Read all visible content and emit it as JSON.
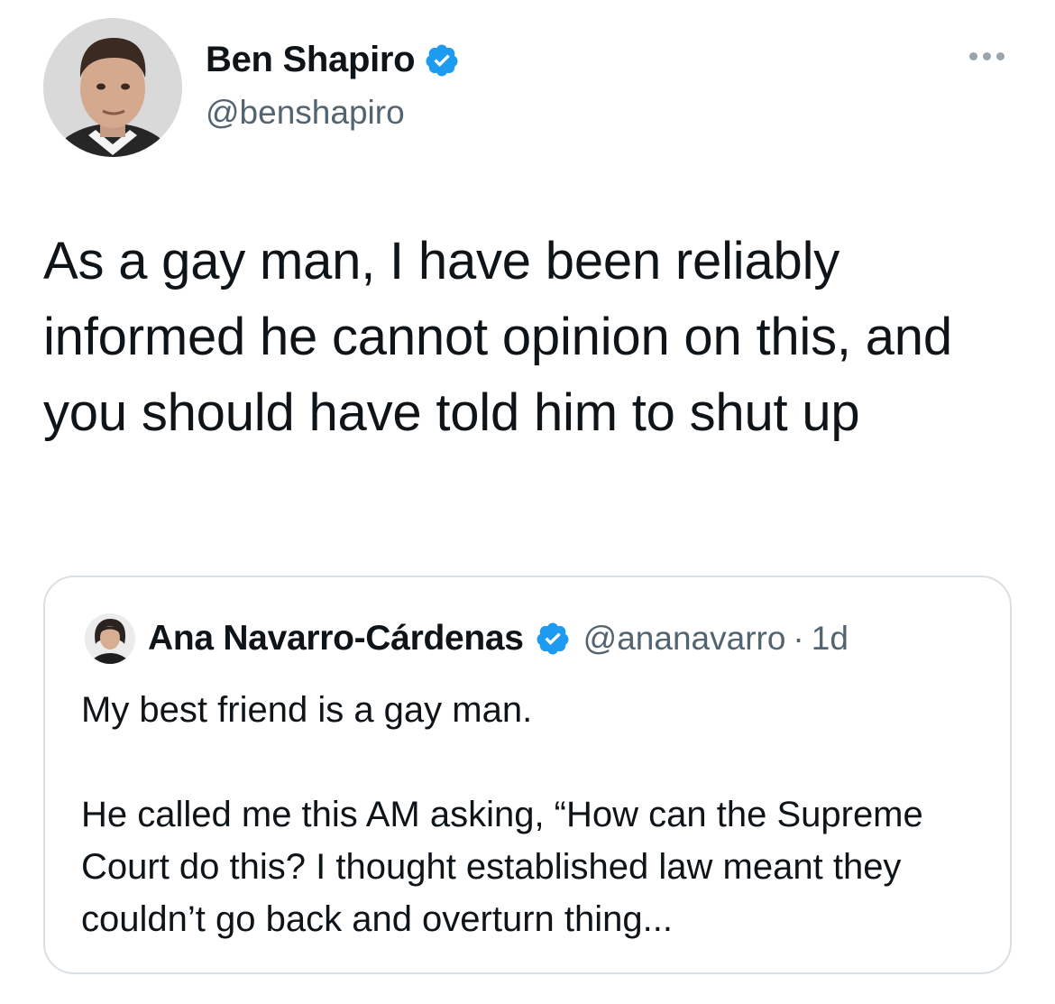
{
  "author": {
    "display_name": "Ben Shapiro",
    "handle": "@benshapiro",
    "verified": true,
    "avatar_icon": "profile-photo"
  },
  "tweet": {
    "text": "As a gay man, I have been reliably informed he cannot opinion on this, and you should have told him to shut up"
  },
  "quoted_tweet": {
    "display_name": "Ana Navarro-Cárdenas",
    "handle": "@ananavarro",
    "separator": "·",
    "time": "1d",
    "verified": true,
    "paragraphs": [
      "My best friend is a gay man.",
      "He called me this AM asking, “How can the Supreme Court do this? I thought established law meant they couldn’t go back and overturn thing..."
    ]
  },
  "colors": {
    "text": "#0f1419",
    "secondary": "#536471",
    "verified_badge": "#1d9bf0",
    "border": "#d9dfe4"
  },
  "icons": {
    "verified": "verified-badge-icon",
    "more": "more-options-icon"
  }
}
